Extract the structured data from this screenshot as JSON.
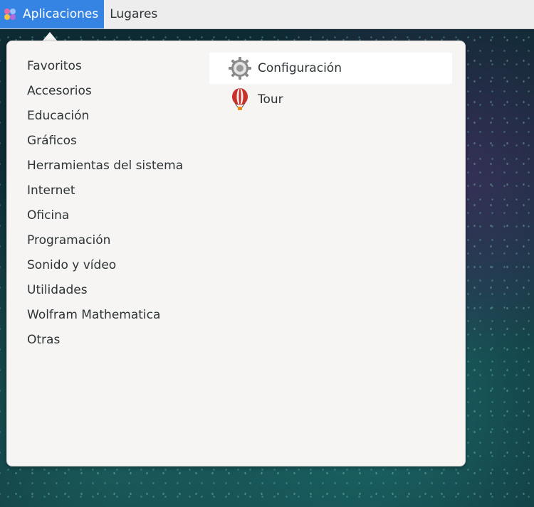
{
  "topbar": {
    "applications_label": "Aplicaciones",
    "places_label": "Lugares"
  },
  "menu": {
    "categories": [
      "Favoritos",
      "Accesorios",
      "Educación",
      "Gráficos",
      "Herramientas del sistema",
      "Internet",
      "Oficina",
      "Programación",
      "Sonido y vídeo",
      "Utilidades",
      "Wolfram Mathematica",
      "Otras"
    ],
    "apps": [
      {
        "label": "Configuración",
        "icon": "gear-icon"
      },
      {
        "label": "Tour",
        "icon": "balloon-icon"
      }
    ]
  },
  "colors": {
    "accent": "#3584e4",
    "menu_bg": "#f6f5f4",
    "text": "#2e3436"
  }
}
